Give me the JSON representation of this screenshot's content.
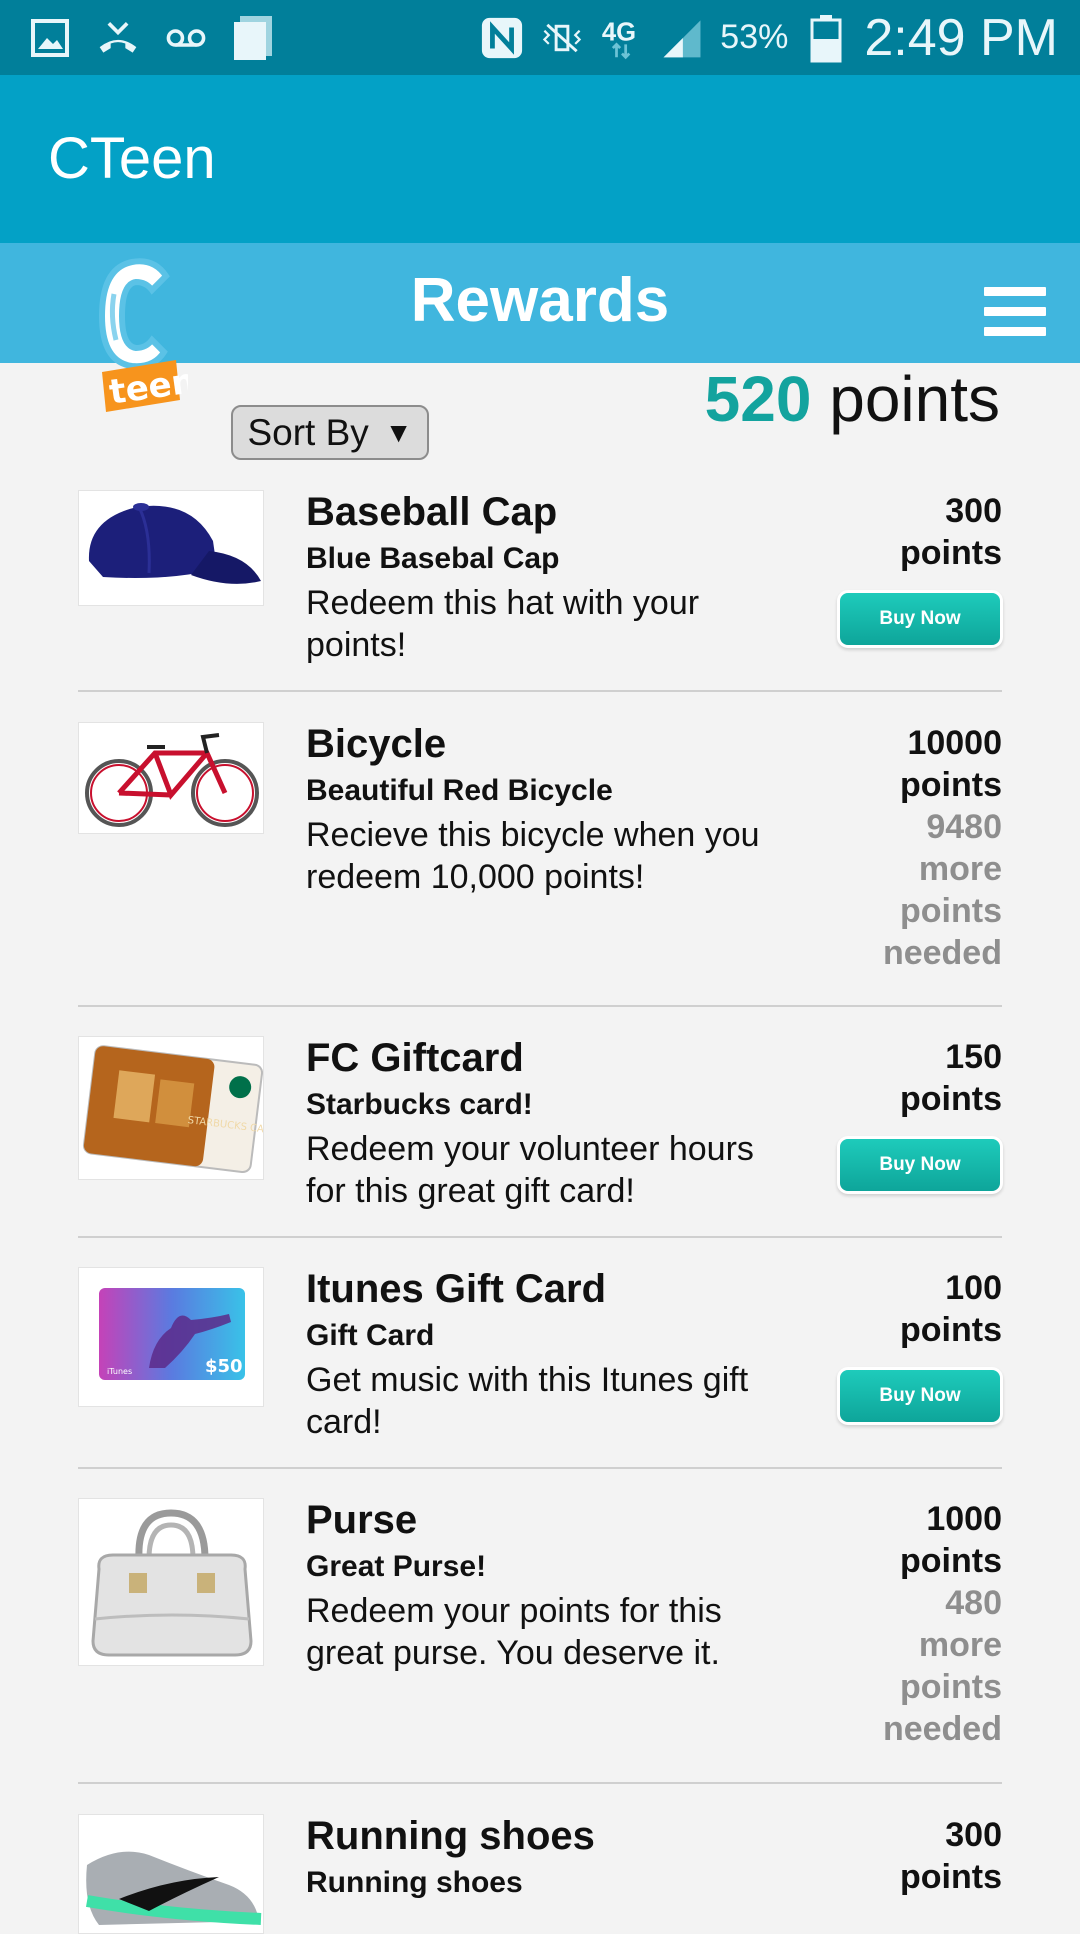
{
  "status_bar": {
    "battery": "53%",
    "time": "2:49 PM",
    "network": "4G"
  },
  "app": {
    "title": "CTeen"
  },
  "header": {
    "title": "Rewards"
  },
  "controls": {
    "sort_label": "Sort By",
    "sort_arrow": "▼"
  },
  "points": {
    "value": "520",
    "unit": "points"
  },
  "rewards": [
    {
      "name": "Baseball Cap",
      "subtitle": "Blue Basebal Cap",
      "description": "Redeem this hat with your points!",
      "cost": "300",
      "cost_unit": "points",
      "buy_label": "Buy Now",
      "thumb_icon": "baseball-cap"
    },
    {
      "name": "Bicycle",
      "subtitle": "Beautiful Red Bicycle",
      "description": "Recieve this bicycle when you redeem 10,000 points!",
      "cost": "10000",
      "cost_unit": "points",
      "needed": "9480 more points needed",
      "thumb_icon": "bicycle"
    },
    {
      "name": "FC Giftcard",
      "subtitle": "Starbucks card!",
      "description": "Redeem your volunteer hours for this great gift card!",
      "cost": "150",
      "cost_unit": "points",
      "buy_label": "Buy Now",
      "thumb_icon": "starbucks-card"
    },
    {
      "name": "Itunes Gift Card",
      "subtitle": "Gift Card",
      "description": "Get music with this Itunes gift card!",
      "cost": "100",
      "cost_unit": "points",
      "buy_label": "Buy Now",
      "thumb_icon": "itunes-card"
    },
    {
      "name": "Purse",
      "subtitle": "Great Purse!",
      "description": "Redeem your points for this great purse. You deserve it.",
      "cost": "1000",
      "cost_unit": "points",
      "needed": "480 more points needed",
      "thumb_icon": "purse"
    },
    {
      "name": "Running shoes",
      "subtitle": "Running shoes",
      "cost": "300",
      "cost_unit": "points",
      "thumb_icon": "running-shoe"
    }
  ],
  "colors": {
    "status_bar": "#017f9a",
    "app_bar": "#03a1c6",
    "rewards_bar": "#40b6de",
    "points_accent": "#13a39e",
    "buy_button": "#1ab8ab"
  }
}
